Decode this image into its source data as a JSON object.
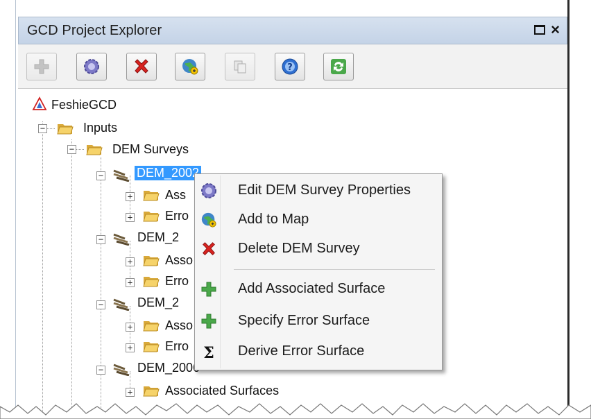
{
  "panel": {
    "title": "GCD Project Explorer",
    "controls": {
      "maximize": "maximize-icon",
      "close": "×"
    }
  },
  "toolbar": {
    "buttons": [
      {
        "icon": "add-icon",
        "enabled": false
      },
      {
        "icon": "properties-gear-icon",
        "enabled": true
      },
      {
        "icon": "delete-icon",
        "enabled": true
      },
      {
        "icon": "add-to-map-icon",
        "enabled": true
      },
      {
        "icon": "copy-icon",
        "enabled": false
      },
      {
        "icon": "help-icon",
        "enabled": true
      },
      {
        "icon": "refresh-icon",
        "enabled": true
      }
    ]
  },
  "tree": {
    "root": "FeshieGCD",
    "inputs": "Inputs",
    "dem_surveys": "DEM Surveys",
    "items": [
      {
        "label": "DEM_2002",
        "selected": true,
        "children": [
          "Ass",
          "Erro"
        ]
      },
      {
        "label": "DEM_2",
        "selected": false,
        "children": [
          "Asso",
          "Erro"
        ]
      },
      {
        "label": "DEM_2",
        "selected": false,
        "children": [
          "Asso",
          "Erro"
        ]
      },
      {
        "label": "DEM_2006",
        "selected": false,
        "children": [
          "Associated Surfaces"
        ]
      }
    ]
  },
  "context_menu": {
    "items": [
      {
        "label": "Edit DEM Survey Properties",
        "icon": "properties-gear-icon"
      },
      {
        "label": "Add to Map",
        "icon": "add-to-map-icon"
      },
      {
        "label": "Delete DEM Survey",
        "icon": "delete-icon"
      },
      {
        "label": "Add Associated Surface",
        "icon": "add-icon"
      },
      {
        "label": "Specify Error Surface",
        "icon": "add-icon"
      },
      {
        "label": "Derive Error Surface",
        "icon": "sigma-icon"
      }
    ]
  },
  "colors": {
    "selection": "#3399ff",
    "titlebar": "#c9d7ea",
    "delete_red": "#d8231f",
    "add_green": "#4aa84a"
  }
}
